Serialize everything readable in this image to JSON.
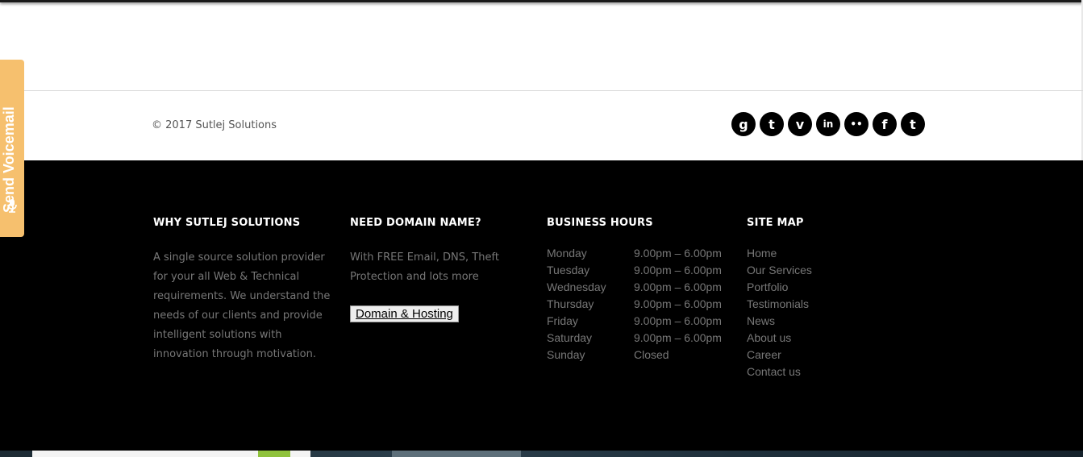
{
  "copyright": "© 2017 Sutlej Solutions",
  "social": [
    {
      "name": "google-plus-icon",
      "glyph": "g"
    },
    {
      "name": "tumblr-icon",
      "glyph": "t"
    },
    {
      "name": "vimeo-icon",
      "glyph": "v"
    },
    {
      "name": "linkedin-icon",
      "glyph": "in"
    },
    {
      "name": "flickr-icon",
      "glyph": "••"
    },
    {
      "name": "facebook-icon",
      "glyph": "f"
    },
    {
      "name": "twitter-icon",
      "glyph": "t"
    }
  ],
  "why": {
    "heading": "WHY SUTLEJ SOLUTIONS",
    "text": "A single source solution provider for your all Web & Technical requirements. We understand the needs of our clients and provide intelligent solutions with innovation through motivation."
  },
  "domain": {
    "heading": "NEED DOMAIN NAME?",
    "text": "With FREE Email, DNS, Theft Protection and lots more",
    "button": "Domain & Hosting"
  },
  "hours": {
    "heading": "BUSINESS HOURS",
    "rows": [
      {
        "day": "Monday",
        "time": "9.00pm – 6.00pm"
      },
      {
        "day": "Tuesday",
        "time": "9.00pm – 6.00pm"
      },
      {
        "day": "Wednesday",
        "time": "9.00pm – 6.00pm"
      },
      {
        "day": "Thursday",
        "time": "9.00pm – 6.00pm"
      },
      {
        "day": "Friday",
        "time": "9.00pm – 6.00pm"
      },
      {
        "day": "Saturday",
        "time": "9.00pm – 6.00pm"
      },
      {
        "day": "Sunday",
        "time": "Closed"
      }
    ]
  },
  "sitemap": {
    "heading": "SITE MAP",
    "links": [
      "Home",
      "Our Services",
      "Portfolio",
      "Testimonials",
      "News",
      "About us",
      "Career",
      "Contact us"
    ]
  },
  "voicemail": {
    "label": "Send Voicemail",
    "icon": "microphone-icon"
  },
  "colors": {
    "footer_bg": "#000000",
    "voicemail_tab": "#f6c06e",
    "muted_text": "#777777"
  }
}
